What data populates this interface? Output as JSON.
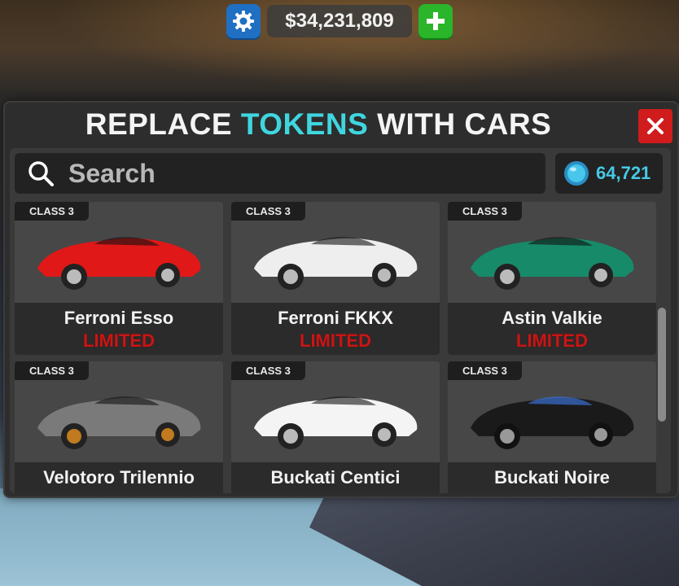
{
  "topbar": {
    "money": "$34,231,809",
    "settings_icon": "gear-icon",
    "plus_icon": "plus-icon",
    "colors": {
      "settings": "#1f6fc2",
      "plus": "#2ab52a"
    }
  },
  "modal": {
    "title_part1": "REPLACE ",
    "title_accent": "TOKENS",
    "title_part2": " WITH CARS",
    "accent_color": "#3fd6e0",
    "close_icon": "close-icon",
    "search_placeholder": "Search",
    "token_count": "64,721",
    "cars": [
      {
        "class": "CLASS 3",
        "name": "Ferroni Esso",
        "tag": "LIMITED",
        "color": "#e01818"
      },
      {
        "class": "CLASS 3",
        "name": "Ferroni FKKX",
        "tag": "LIMITED",
        "color": "#eeeeee"
      },
      {
        "class": "CLASS 3",
        "name": "Astin Valkie",
        "tag": "LIMITED",
        "color": "#178a6a"
      },
      {
        "class": "CLASS 3",
        "name": "Velotoro Trilennio",
        "tag": "",
        "color": "#7a7a7a"
      },
      {
        "class": "CLASS 3",
        "name": "Buckati Centici",
        "tag": "",
        "color": "#f4f4f4"
      },
      {
        "class": "CLASS 3",
        "name": "Buckati Noire",
        "tag": "",
        "color": "#1a1a1a"
      }
    ]
  }
}
